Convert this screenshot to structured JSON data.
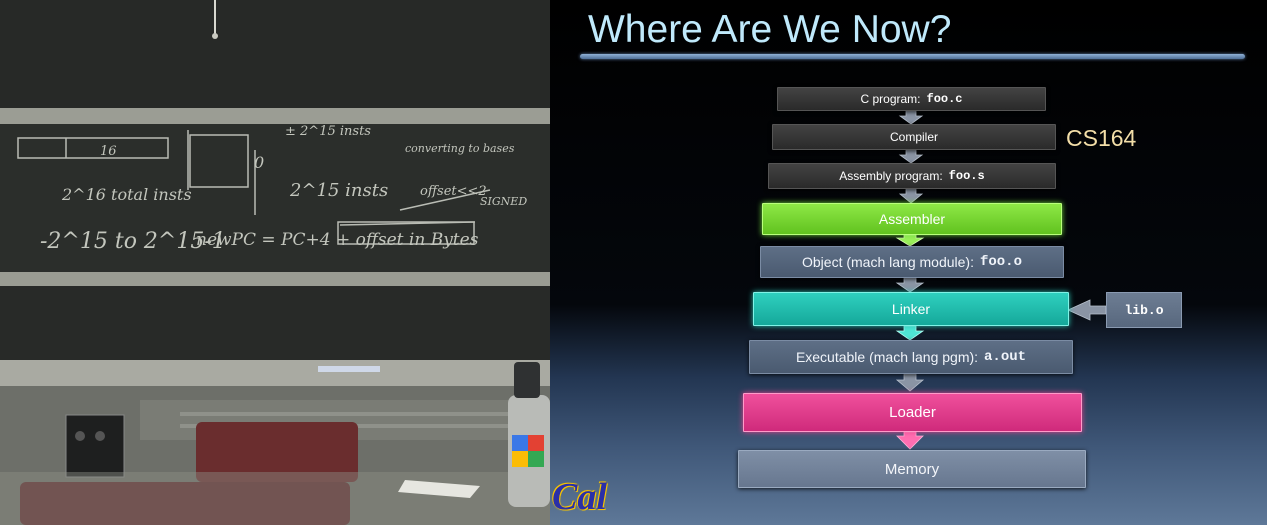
{
  "slide": {
    "title": "Where Are We Now?",
    "side_label": "CS164",
    "side_input": "lib.o",
    "logo_text": "Cal",
    "steps": [
      {
        "text": "C program:",
        "code": "foo.c",
        "color": "#3a3a3a"
      },
      {
        "text": "Compiler",
        "code": "",
        "color": "#3a3a3a"
      },
      {
        "text": "Assembly program:",
        "code": "foo.s",
        "color": "#3a3a3a"
      },
      {
        "text": "Assembler",
        "code": "",
        "color": "#7ed33a"
      },
      {
        "text": "Object (mach lang module):",
        "code": "foo.o",
        "color": "#56667c"
      },
      {
        "text": "Linker",
        "code": "",
        "color": "#22bcad"
      },
      {
        "text": "Executable (mach lang pgm):",
        "code": "a.out",
        "color": "#56667c"
      },
      {
        "text": "Loader",
        "code": "",
        "color": "#e03d8b"
      },
      {
        "text": "Memory",
        "code": "",
        "color": "#7484a0"
      }
    ]
  },
  "board": {
    "chalk": [
      "16",
      "2^16 total insts",
      "± 2^15 insts",
      "2^15 insts",
      "converting to bases",
      "offset<<2",
      "SIGNED",
      "-2^15 to 2^15-1",
      "newPC = PC+4 + offset in Bytes",
      "0"
    ]
  }
}
